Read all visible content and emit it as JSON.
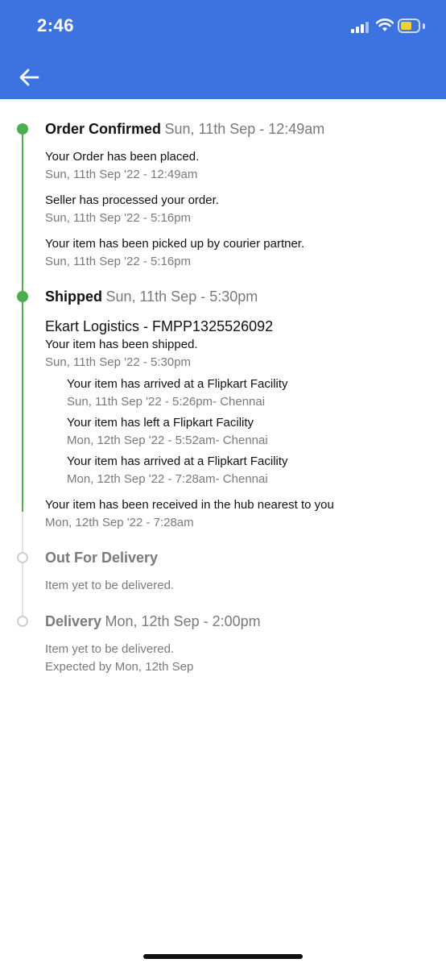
{
  "status_bar": {
    "time": "2:46",
    "signal_icon": "cellular-signal-icon",
    "wifi_icon": "wifi-icon",
    "battery_icon": "battery-icon",
    "battery_level_fraction": 0.45,
    "colors": {
      "background": "#3d73e0",
      "battery_fill": "#f4cf33"
    }
  },
  "app_bar": {
    "back_icon": "arrow-left-icon",
    "color": "#3d73e0"
  },
  "timeline": {
    "colors": {
      "complete": "#4caf50",
      "pending": "#cfcfcf"
    },
    "order_confirmed": {
      "title": "Order Confirmed",
      "date": "Sun, 11th Sep - 12:49am",
      "status": "complete",
      "events": [
        {
          "message": "Your Order has been placed.",
          "date": "Sun, 11th Sep '22 - 12:49am"
        },
        {
          "message": "Seller has processed your order.",
          "date": "Sun, 11th Sep '22 - 5:16pm"
        },
        {
          "message": "Your item has been picked up by courier partner.",
          "date": "Sun, 11th Sep '22 - 5:16pm"
        }
      ]
    },
    "shipped": {
      "title": "Shipped",
      "date": "Sun, 11th Sep - 5:30pm",
      "status": "complete",
      "carrier": "Ekart Logistics - FMPP1325526092",
      "message": "Your item has been shipped.",
      "message_date": "Sun, 11th Sep '22 - 5:30pm",
      "sub_events": [
        {
          "message": "Your item has arrived at a Flipkart Facility",
          "date": "Sun, 11th Sep '22 - 5:26pm- Chennai"
        },
        {
          "message": "Your item has left a Flipkart Facility",
          "date": "Mon, 12th Sep '22 - 5:52am- Chennai"
        },
        {
          "message": "Your item has arrived at a Flipkart Facility",
          "date": "Mon, 12th Sep '22 - 7:28am- Chennai"
        }
      ],
      "hub_message": "Your item has been received in the hub nearest to you",
      "hub_date": "Mon, 12th Sep '22 - 7:28am"
    },
    "out_for_delivery": {
      "title": "Out For Delivery",
      "status": "pending",
      "message": "Item yet to be delivered."
    },
    "delivery": {
      "title": "Delivery",
      "date": "Mon, 12th Sep - 2:00pm",
      "status": "pending",
      "message": "Item yet to be delivered.",
      "expected": "Expected by Mon, 12th Sep"
    }
  }
}
